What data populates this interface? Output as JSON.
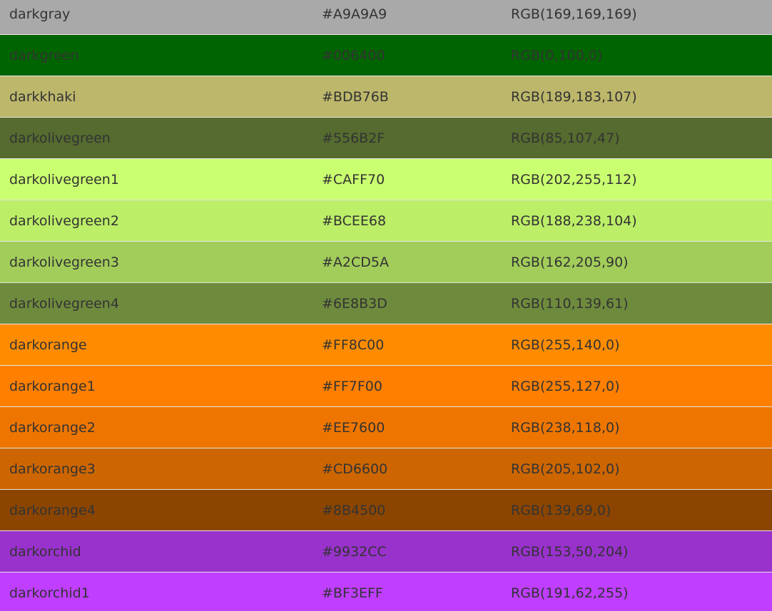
{
  "colors": [
    {
      "name": "darkgray",
      "hex": "#A9A9A9",
      "rgb": "RGB(169,169,169)"
    },
    {
      "name": "darkgreen",
      "hex": "#006400",
      "rgb": "RGB(0,100,0)"
    },
    {
      "name": "darkkhaki",
      "hex": "#BDB76B",
      "rgb": "RGB(189,183,107)"
    },
    {
      "name": "darkolivegreen",
      "hex": "#556B2F",
      "rgb": "RGB(85,107,47)"
    },
    {
      "name": "darkolivegreen1",
      "hex": "#CAFF70",
      "rgb": "RGB(202,255,112)"
    },
    {
      "name": "darkolivegreen2",
      "hex": "#BCEE68",
      "rgb": "RGB(188,238,104)"
    },
    {
      "name": "darkolivegreen3",
      "hex": "#A2CD5A",
      "rgb": "RGB(162,205,90)"
    },
    {
      "name": "darkolivegreen4",
      "hex": "#6E8B3D",
      "rgb": "RGB(110,139,61)"
    },
    {
      "name": "darkorange",
      "hex": "#FF8C00",
      "rgb": "RGB(255,140,0)"
    },
    {
      "name": "darkorange1",
      "hex": "#FF7F00",
      "rgb": "RGB(255,127,0)"
    },
    {
      "name": "darkorange2",
      "hex": "#EE7600",
      "rgb": "RGB(238,118,0)"
    },
    {
      "name": "darkorange3",
      "hex": "#CD6600",
      "rgb": "RGB(205,102,0)"
    },
    {
      "name": "darkorange4",
      "hex": "#8B4500",
      "rgb": "RGB(139,69,0)"
    },
    {
      "name": "darkorchid",
      "hex": "#9932CC",
      "rgb": "RGB(153,50,204)"
    },
    {
      "name": "darkorchid1",
      "hex": "#BF3EFF",
      "rgb": "RGB(191,62,255)"
    }
  ]
}
